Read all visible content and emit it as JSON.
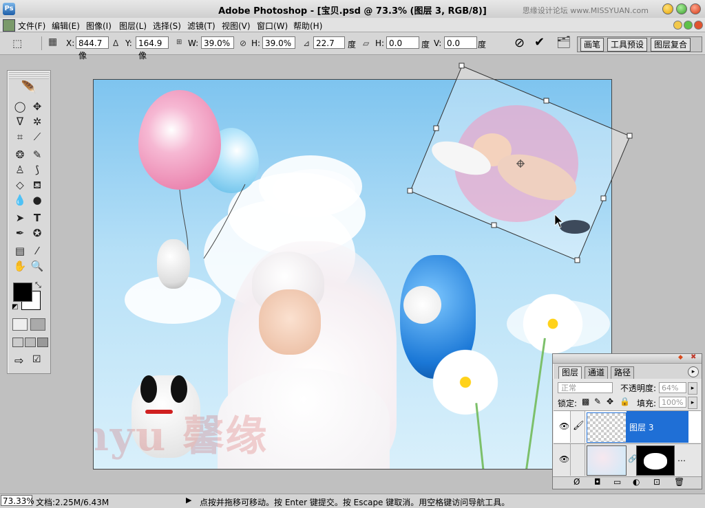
{
  "window": {
    "title": "Adobe Photoshop - [宝贝.psd @ 73.3% (图层 3, RGB/8)]",
    "watermark": "思缘设计论坛 www.MISSYUAN.com"
  },
  "menu": [
    "文件(F)",
    "编辑(E)",
    "图像(I)",
    "图层(L)",
    "选择(S)",
    "滤镜(T)",
    "视图(V)",
    "窗口(W)",
    "帮助(H)"
  ],
  "options": {
    "x_label": "X:",
    "x_value": "844.7 像",
    "y_label": "Y:",
    "y_value": "164.9 像",
    "w_label": "W:",
    "w_value": "39.0%",
    "h_label": "H:",
    "h_value": "39.0%",
    "angle_value": "22.7",
    "angle_unit": "度",
    "hskew_label": "H:",
    "hskew_value": "0.0",
    "hskew_unit": "度",
    "vskew_label": "V:",
    "vskew_value": "0.0",
    "vskew_unit": "度",
    "cancel_icon": "cancel-icon",
    "commit_icon": "commit-icon",
    "tabs": [
      "画笔",
      "工具预设",
      "图层复合"
    ]
  },
  "canvas": {
    "watermark": "Xinyu 馨缘"
  },
  "layers_panel": {
    "tabs": [
      "图层",
      "通道",
      "路径"
    ],
    "blend_mode": "正常",
    "opacity_label": "不透明度:",
    "opacity_value": "64%",
    "lock_label": "锁定:",
    "fill_label": "填充:",
    "fill_value": "100%",
    "layers": [
      {
        "name": "图层 3",
        "selected": true
      },
      {
        "name": "",
        "selected": false
      }
    ]
  },
  "status": {
    "zoom": "73.33%",
    "doc": "文档:2.25M/6.43M",
    "hint": "点按并拖移可移动。按 Enter 键提交。按 Escape 键取消。用空格键访问导航工具。"
  },
  "colors": {
    "selected_layer": "#1f6fd6",
    "foreground": "#000000",
    "background": "#ffffff"
  }
}
